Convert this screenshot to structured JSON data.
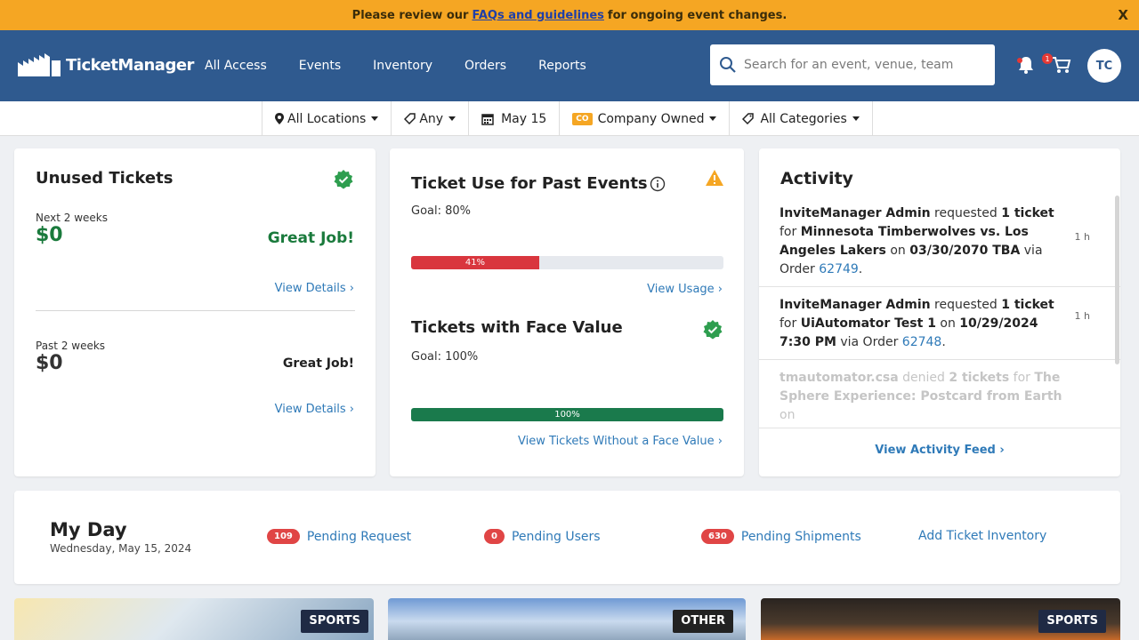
{
  "banner": {
    "prefix": "Please review our",
    "link": "FAQs and guidelines",
    "suffix": "for ongoing event changes.",
    "close": "X"
  },
  "header": {
    "logo_text": "TicketManager",
    "nav": [
      "All Access",
      "Events",
      "Inventory",
      "Orders",
      "Reports"
    ],
    "search_placeholder": "Search for an event, venue, team",
    "cart_count": "1",
    "avatar_initials": "TC"
  },
  "filters": {
    "location": "All Locations",
    "any": "Any",
    "date": "May 15",
    "owner_badge": "CO",
    "owner": "Company Owned",
    "categories": "All Categories"
  },
  "unused": {
    "title": "Unused Tickets",
    "next_label": "Next 2 weeks",
    "next_value": "$0",
    "next_status": "Great Job!",
    "past_label": "Past 2 weeks",
    "past_value": "$0",
    "past_status": "Great Job!",
    "view_details": "View Details ›"
  },
  "usage": {
    "title": "Ticket Use for Past Events",
    "goal": "Goal: 80%",
    "percent": 41,
    "percent_label": "41%",
    "link": "View Usage ›",
    "face_title": "Tickets with Face Value",
    "face_goal": "Goal: 100%",
    "face_percent": 100,
    "face_percent_label": "100%",
    "face_link": "View Tickets Without a Face Value ›"
  },
  "activity": {
    "title": "Activity",
    "items": [
      {
        "actor": "InviteManager Admin",
        "verb": "requested",
        "qty": "1 ticket",
        "for": "for",
        "event": "Minnesota Timberwolves vs. Los Angeles Lakers",
        "on": "on",
        "date": "03/30/2070 TBA",
        "via": "via Order",
        "order": "62749",
        "time": "1 h"
      },
      {
        "actor": "InviteManager Admin",
        "verb": "requested",
        "qty": "1 ticket",
        "for": "for",
        "event": "UiAutomator Test 1",
        "on": "on",
        "date": "10/29/2024 7:30 PM",
        "via": "via Order",
        "order": "62748",
        "time": "1 h"
      },
      {
        "actor": "tmautomator.csa",
        "verb": "denied",
        "qty": "2 tickets",
        "for": "for",
        "event": "The Sphere Experience: Postcard from Earth",
        "on": "on",
        "date": "",
        "via": "",
        "order": "",
        "time": ""
      }
    ],
    "feed_link": "View Activity Feed ›"
  },
  "myday": {
    "title": "My Day",
    "date": "Wednesday, May 15, 2024",
    "pending_request_count": "109",
    "pending_request": "Pending Request",
    "pending_users_count": "0",
    "pending_users": "Pending Users",
    "pending_shipments_count": "630",
    "pending_shipments": "Pending Shipments",
    "add_inventory": "Add Ticket Inventory"
  },
  "tiles": [
    "SPORTS",
    "OTHER",
    "SPORTS"
  ],
  "colors": {
    "banner": "#f5a623",
    "header": "#2f5a8f",
    "link": "#2f7ab8",
    "success": "#1a7a3c",
    "danger": "#d9363e"
  }
}
